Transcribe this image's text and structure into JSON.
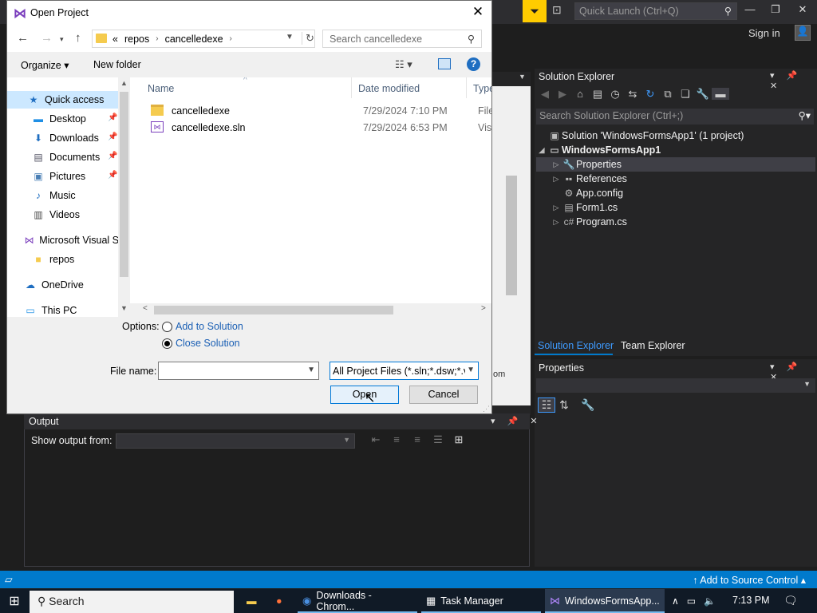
{
  "vs": {
    "quick_launch_placeholder": "Quick Launch (Ctrl+Q)",
    "sign_in": "Sign in",
    "filter_icon": "filter-icon",
    "behind_editor_text": "om"
  },
  "solution_explorer": {
    "title": "Solution Explorer",
    "search_placeholder": "Search Solution Explorer (Ctrl+;)",
    "tree": [
      {
        "label": "Solution 'WindowsFormsApp1' (1 project)",
        "bold": false
      },
      {
        "label": "WindowsFormsApp1",
        "bold": true
      },
      {
        "label": "Properties",
        "bold": false
      },
      {
        "label": "References",
        "bold": false
      },
      {
        "label": "App.config",
        "bold": false
      },
      {
        "label": "Form1.cs",
        "bold": false
      },
      {
        "label": "Program.cs",
        "bold": false
      }
    ],
    "tabs": [
      "Solution Explorer",
      "Team Explorer"
    ]
  },
  "properties": {
    "title": "Properties"
  },
  "output": {
    "title": "Output",
    "show_from": "Show output from:"
  },
  "status_bar": {
    "source_control": "Add to Source Control"
  },
  "taskbar": {
    "search": "Search",
    "items": [
      "Downloads - Chrom...",
      "Task Manager",
      "WindowsFormsApp..."
    ],
    "time": "7:13 PM"
  },
  "dialog": {
    "title": "Open Project",
    "address": {
      "overflow": "«",
      "crumbs": [
        "repos",
        "cancelledexe"
      ]
    },
    "search_placeholder": "Search cancelledexe",
    "organize": "Organize",
    "new_folder": "New folder",
    "nav_items": [
      {
        "label": "Quick access",
        "icon": "star-icon"
      },
      {
        "label": "Desktop",
        "icon": "desktop-icon"
      },
      {
        "label": "Downloads",
        "icon": "download-icon"
      },
      {
        "label": "Documents",
        "icon": "documents-icon"
      },
      {
        "label": "Pictures",
        "icon": "pictures-icon"
      },
      {
        "label": "Music",
        "icon": "music-icon"
      },
      {
        "label": "Videos",
        "icon": "videos-icon"
      },
      {
        "label": "Microsoft Visual S",
        "icon": "visual-studio-icon"
      },
      {
        "label": "repos",
        "icon": "folder-icon"
      },
      {
        "label": "OneDrive",
        "icon": "cloud-icon"
      },
      {
        "label": "This PC",
        "icon": "computer-icon"
      }
    ],
    "columns": [
      "Name",
      "Date modified",
      "Type"
    ],
    "files": [
      {
        "name": "cancelledexe",
        "date": "7/29/2024 7:10 PM",
        "type": "File fo",
        "kind": "folder"
      },
      {
        "name": "cancelledexe.sln",
        "date": "7/29/2024 6:53 PM",
        "type": "Visua",
        "kind": "solution"
      }
    ],
    "options_label": "Options:",
    "option_add": "Add to Solution",
    "option_close": "Close Solution",
    "option_selected": "Close Solution",
    "file_name_label": "File name:",
    "file_name_value": "",
    "filter": "All Project Files (*.sln;*.dsw;*.vc",
    "open": "Open",
    "cancel": "Cancel"
  }
}
